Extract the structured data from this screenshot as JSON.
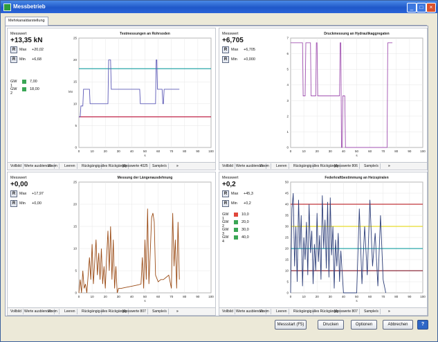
{
  "window": {
    "title": "Messbetrieb",
    "minimize": "_",
    "maximize": "□",
    "close": "×"
  },
  "tab": {
    "label": "Mehrkanaldarstellung"
  },
  "ro_label": "Messwert",
  "max_label": "Max",
  "min_label": "Min",
  "r_label": "R",
  "panels": [
    {
      "value": "+13,35 kN",
      "max": "+20,02",
      "min": "+6,68",
      "gw": [
        {
          "label": "GW 1",
          "value": "7,00",
          "color": "#3aa655"
        },
        {
          "label": "GW 2",
          "value": "18,00",
          "color": "#3aa655"
        }
      ],
      "toolbar": [
        "Vollbild",
        "Werte ausblenden",
        "Zoom",
        "Leeren",
        "Rückgängig",
        "alles Rückgängig",
        "Messwerte 4025",
        "Sample/s",
        "»"
      ]
    },
    {
      "value": "+6,705",
      "max": "+6,705",
      "min": "+0,000",
      "gw": [],
      "toolbar": [
        "Vollbild",
        "Werte ausblenden",
        "Zoom",
        "Leeren",
        "Rückgängig",
        "alles Rückgängig",
        "Messwerte 806",
        "Sample/s",
        "»"
      ]
    },
    {
      "value": "+0,00",
      "max": "+17,97",
      "min": "+0,00",
      "gw": [],
      "toolbar": [
        "Vollbild",
        "Werte ausblenden",
        "Zoom",
        "Leeren",
        "Rückgängig",
        "alles Rückgängig",
        "Messwerte 807",
        "Sample/s",
        "»"
      ]
    },
    {
      "value": "+0,2",
      "max": "+45,3",
      "min": "+0,2",
      "gw": [
        {
          "label": "GW 1",
          "value": "10,0",
          "color": "#e0463b"
        },
        {
          "label": "GW 2",
          "value": "20,0",
          "color": "#3aa655"
        },
        {
          "label": "GW 3",
          "value": "30,0",
          "color": "#3aa655"
        },
        {
          "label": "GW 4",
          "value": "40,0",
          "color": "#3aa655"
        }
      ],
      "toolbar": [
        "Vollbild",
        "Werte ausblenden",
        "Zoom",
        "Leeren",
        "Rückgängig",
        "alles Rückgängig",
        "Messwerte 807",
        "Sample/s",
        "»"
      ]
    }
  ],
  "footer": {
    "messstart": "Messstart (F5)",
    "drucken": "Drucken",
    "optionen": "Optionen",
    "abbrechen": "Abbrechen",
    "help": "?"
  },
  "chart_data": [
    {
      "type": "line",
      "title": "Testmessungen an Rohrsoden",
      "xlabel": "s",
      "ylabel": "kN",
      "xlim": [
        0,
        100
      ],
      "ylim": [
        0,
        25
      ],
      "xticks": [
        0,
        10,
        20,
        30,
        40,
        50,
        60,
        70,
        80,
        90,
        100
      ],
      "yticks": [
        0,
        5,
        10,
        15,
        20,
        25
      ],
      "series": [
        {
          "color": "#5b58b6",
          "x": [
            0,
            1,
            1.5,
            3,
            3.5,
            8,
            8.5,
            22,
            22.5,
            24,
            24.5,
            46,
            46.5,
            58,
            58.5,
            59,
            59.5,
            63,
            63.5,
            64,
            64.5,
            76
          ],
          "y": [
            7,
            7,
            9.5,
            9.5,
            13.3,
            13.3,
            10,
            10,
            20,
            20,
            13.3,
            13.3,
            10,
            10,
            20,
            20,
            13.3,
            13.3,
            10,
            10,
            13.3,
            13.3
          ]
        }
      ],
      "hlines": [
        {
          "y": 18,
          "color": "#2aa6a9"
        },
        {
          "y": 7,
          "color": "#c0254a"
        }
      ]
    },
    {
      "type": "line",
      "title": "Druckmessung an Hydraulikaggregaten",
      "xlabel": "s",
      "ylabel": "",
      "xlim": [
        0,
        100
      ],
      "ylim": [
        0,
        7
      ],
      "xticks": [
        0,
        10,
        20,
        30,
        40,
        50,
        60,
        70,
        80,
        90,
        100
      ],
      "yticks": [
        0,
        1,
        2,
        3,
        4,
        5,
        6,
        7
      ],
      "series": [
        {
          "color": "#a050b0",
          "x": [
            0,
            9,
            9.5,
            11,
            11.5,
            15,
            15.5,
            19,
            19.5,
            20,
            20.5,
            37,
            37.5,
            38,
            38.5,
            39,
            39.5,
            41,
            41.5,
            55,
            55.5,
            73,
            73.5,
            77
          ],
          "y": [
            6.7,
            6.7,
            3.3,
            3.3,
            6.7,
            6.7,
            3.3,
            3.3,
            6.7,
            6.7,
            3.3,
            3.3,
            6.7,
            6.7,
            0,
            0,
            3.3,
            3.3,
            0,
            0,
            0,
            0,
            6.7,
            6.7
          ]
        }
      ],
      "hlines": []
    },
    {
      "type": "line",
      "title": "Messung der Längenausdehnung",
      "xlabel": "s",
      "ylabel": "",
      "xlim": [
        0,
        100
      ],
      "ylim": [
        0,
        25
      ],
      "xticks": [
        0,
        10,
        20,
        30,
        40,
        50,
        60,
        70,
        80,
        90,
        100
      ],
      "yticks": [
        0,
        5,
        10,
        15,
        20,
        25
      ],
      "series": [
        {
          "color": "#9a4a14",
          "x": [
            0,
            1,
            2,
            3,
            4,
            5,
            6,
            7,
            8,
            9,
            10,
            11,
            12,
            13,
            14,
            15,
            16,
            17,
            18,
            19,
            20,
            21,
            22,
            23,
            24,
            25,
            26,
            27,
            28,
            29,
            30,
            32,
            35,
            40,
            45,
            47,
            48,
            49,
            50,
            51,
            52,
            53,
            54,
            55,
            56,
            57,
            58,
            60,
            62,
            64,
            66,
            68,
            70,
            71,
            72,
            73,
            74,
            75,
            76
          ],
          "y": [
            0,
            3,
            0,
            5,
            1,
            2,
            0,
            4,
            8,
            3,
            11,
            2,
            7,
            12,
            4,
            9,
            3,
            10,
            2,
            6,
            1,
            8,
            14,
            5,
            15,
            3,
            12,
            1,
            6,
            0,
            1,
            1,
            1.2,
            1.5,
            1.8,
            2,
            8,
            1,
            12,
            3,
            19,
            2,
            9,
            17,
            18,
            16,
            4,
            2.5,
            3,
            3,
            3.5,
            4,
            1,
            18,
            6,
            12,
            1,
            16,
            3
          ]
        }
      ],
      "hlines": []
    },
    {
      "type": "line",
      "title": "Federkraftbestimmung an Heizspiralen",
      "xlabel": "s",
      "ylabel": "",
      "xlim": [
        0,
        100
      ],
      "ylim": [
        0,
        50
      ],
      "xticks": [
        0,
        10,
        20,
        30,
        40,
        50,
        60,
        70,
        80,
        90,
        100
      ],
      "yticks": [
        0,
        5,
        10,
        15,
        20,
        25,
        30,
        35,
        40,
        45,
        50
      ],
      "series": [
        {
          "color": "#2e3f7a",
          "x": [
            0,
            1,
            2,
            3,
            4,
            5,
            6,
            7,
            8,
            9,
            10,
            11,
            12,
            13,
            14,
            15,
            16,
            17,
            18,
            19,
            20,
            21,
            22,
            23,
            24,
            25,
            26,
            27,
            28,
            29,
            30,
            31,
            32,
            33,
            34,
            35,
            36,
            37,
            38,
            39,
            40,
            42,
            44,
            46,
            48,
            50,
            52,
            54,
            56,
            58,
            60,
            62,
            64,
            66,
            68,
            70,
            72
          ],
          "y": [
            0,
            38,
            45,
            12,
            30,
            5,
            42,
            20,
            35,
            3,
            25,
            15,
            32,
            8,
            40,
            18,
            28,
            4,
            22,
            10,
            36,
            14,
            26,
            6,
            44,
            20,
            33,
            11,
            41,
            7,
            43,
            17,
            30,
            2,
            24,
            12,
            27,
            5,
            19,
            9,
            0,
            0,
            0,
            0,
            0,
            0,
            38,
            4,
            30,
            8,
            42,
            12,
            27,
            3,
            35,
            6,
            0
          ]
        }
      ],
      "hlines": [
        {
          "y": 40,
          "color": "#c0363b"
        },
        {
          "y": 30,
          "color": "#e8dc2c"
        },
        {
          "y": 20,
          "color": "#2aa6a9"
        },
        {
          "y": 10,
          "color": "#8a2a3a"
        }
      ]
    }
  ]
}
